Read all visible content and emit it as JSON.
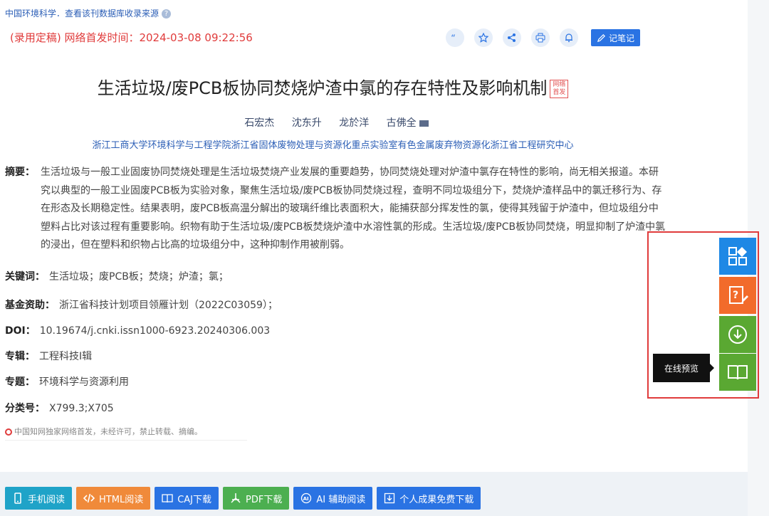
{
  "header": {
    "source_text": "中国环境科学．查看该刊数据库收录来源",
    "help_icon": "?",
    "pubtime": "(录用定稿) 网络首发时间：2024-03-08 09:22:56",
    "note_label": "记笔记"
  },
  "article": {
    "title": "生活垃圾/废PCB板协同焚烧炉渣中氯的存在特性及影响机制",
    "badge": "网络首发",
    "authors": [
      "石宏杰",
      "沈东升",
      "龙於洋",
      "古佛全"
    ],
    "organization": "浙江工商大学环境科学与工程学院浙江省固体废物处理与资源化重点实验室有色金属废弃物资源化浙江省工程研究中心",
    "abstract_label": "摘要：",
    "abstract": "生活垃圾与一般工业固废协同焚烧处理是生活垃圾焚烧产业发展的重要趋势，协同焚烧处理对炉渣中氯存在特性的影响，尚无相关报道。本研究以典型的一般工业固废PCB板为实验对象，聚焦生活垃圾/废PCB板协同焚烧过程，查明不同垃圾组分下，焚烧炉渣样品中的氯迁移行为、存在形态及长期稳定性。结果表明，废PCB板高温分解出的玻璃纤维比表面积大，能捕获部分挥发性的氯，使得其残留于炉渣中，但垃圾组分中塑料占比对该过程有重要影响。织物有助于生活垃圾/废PCB板焚烧炉渣中水溶性氯的形成。生活垃圾/废PCB板协同焚烧，明显抑制了炉渣中氯的浸出，但在塑料和织物占比高的垃圾组分中，这种抑制作用被削弱。",
    "keywords_label": "关键词：",
    "keywords": "生活垃圾；废PCB板；焚烧；炉渣；氯；",
    "fund_label": "基金资助：",
    "fund": "浙江省科技计划项目领雁计划（2022C03059）；",
    "doi_label": "DOI：",
    "doi": "10.19674/j.cnki.issn1000-6923.20240306.003",
    "series_label": "专辑：",
    "series": "工程科技Ⅰ辑",
    "topic_label": "专题：",
    "topic": "环境科学与资源利用",
    "class_label": "分类号：",
    "class": "X799.3;X705",
    "copyright": "中国知网独家网络首发，未经许可，禁止转载、摘编。"
  },
  "bottom_buttons": [
    {
      "label": "手机阅读",
      "color": "#1fa3c8",
      "icon": "phone-icon"
    },
    {
      "label": "HTML阅读",
      "color": "#f08a3a",
      "icon": "code-icon"
    },
    {
      "label": "CAJ下载",
      "color": "#2a73e3",
      "icon": "book-icon"
    },
    {
      "label": "PDF下载",
      "color": "#4caf50",
      "icon": "pdf-icon"
    },
    {
      "label": "AI 辅助阅读",
      "color": "#2a73e3",
      "icon": "ai-icon"
    },
    {
      "label": "个人成果免费下载",
      "color": "#2a73e3",
      "icon": "download-box-icon"
    }
  ],
  "side_tools": {
    "tooltip": "在线预览",
    "colors": {
      "apps": "#1e88e5",
      "question": "#f26b2b",
      "download": "#5aa832",
      "preview": "#5aa832"
    }
  }
}
